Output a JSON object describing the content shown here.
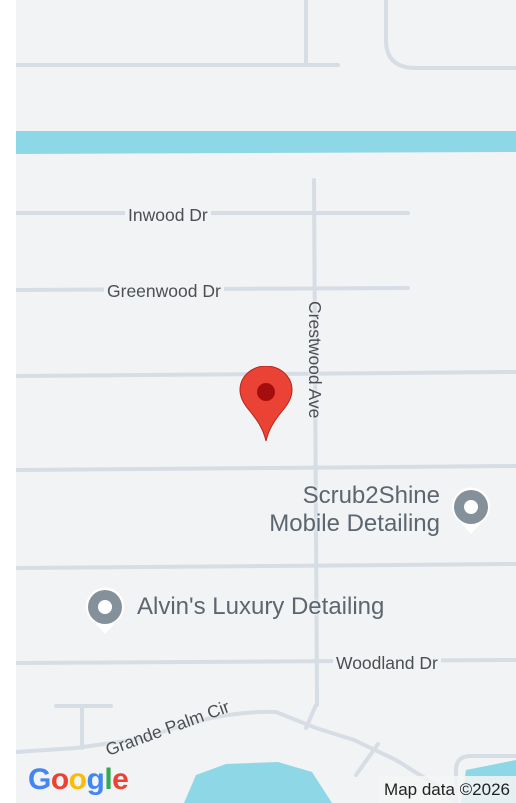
{
  "map": {
    "streets": {
      "inwood": "Inwood Dr",
      "greenwood": "Greenwood Dr",
      "crestwood": "Crestwood Ave",
      "woodland": "Woodland Dr",
      "grande_palm": "Grande Palm Cir"
    },
    "pois": [
      {
        "name_line1": "Scrub2Shine",
        "name_line2": "Mobile Detailing"
      },
      {
        "name": "Alvin's Luxury Detailing"
      }
    ],
    "logo": [
      "G",
      "o",
      "o",
      "g",
      "l",
      "e"
    ],
    "attribution": "Map data ©2026",
    "colors": {
      "land": "#f2f3f4",
      "road": "#d6dde5",
      "water": "#8ed7e6",
      "marker": "#ea4335",
      "poi": "#84919b"
    }
  }
}
